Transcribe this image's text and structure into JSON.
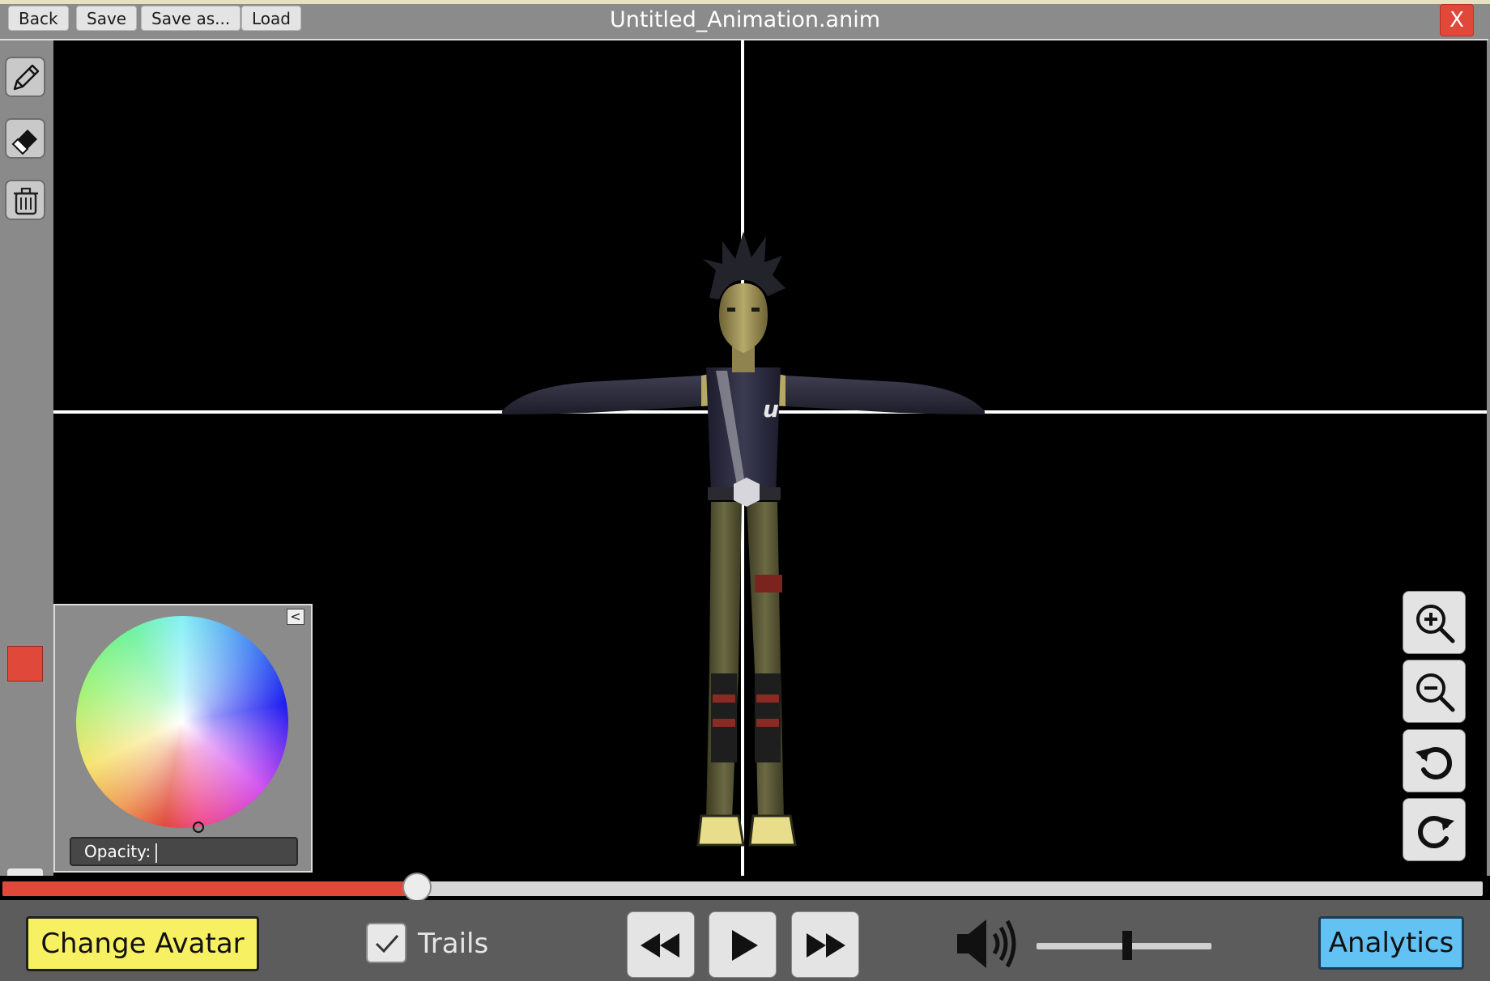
{
  "titlebar": {
    "title": "Untitled_Animation.anim",
    "buttons": [
      "Back",
      "Save",
      "Save as...",
      "Load"
    ],
    "close_label": "X"
  },
  "toolbar": {
    "tools": [
      "pencil-icon",
      "eraser-icon",
      "trash-icon"
    ],
    "current_color": "#e0493a",
    "expand_label": "^"
  },
  "color_picker": {
    "collapse_label": "<",
    "opacity_label": "Opacity:",
    "opacity_value": ""
  },
  "view_controls": [
    "zoom-in-icon",
    "zoom-out-icon",
    "rotate-left-icon",
    "rotate-right-icon"
  ],
  "timeline": {
    "progress_fraction": 0.28,
    "fill_color": "#e0493a"
  },
  "bottom": {
    "change_avatar_label": "Change Avatar",
    "trails_label": "Trails",
    "trails_checked": true,
    "playback": [
      "rewind-icon",
      "play-icon",
      "fast-forward-icon"
    ],
    "volume_fraction": 0.52,
    "analytics_label": "Analytics"
  },
  "colors": {
    "accent_red": "#e0493a",
    "avatar_yellow": "#f7f063",
    "analytics_blue": "#62c2f4"
  }
}
